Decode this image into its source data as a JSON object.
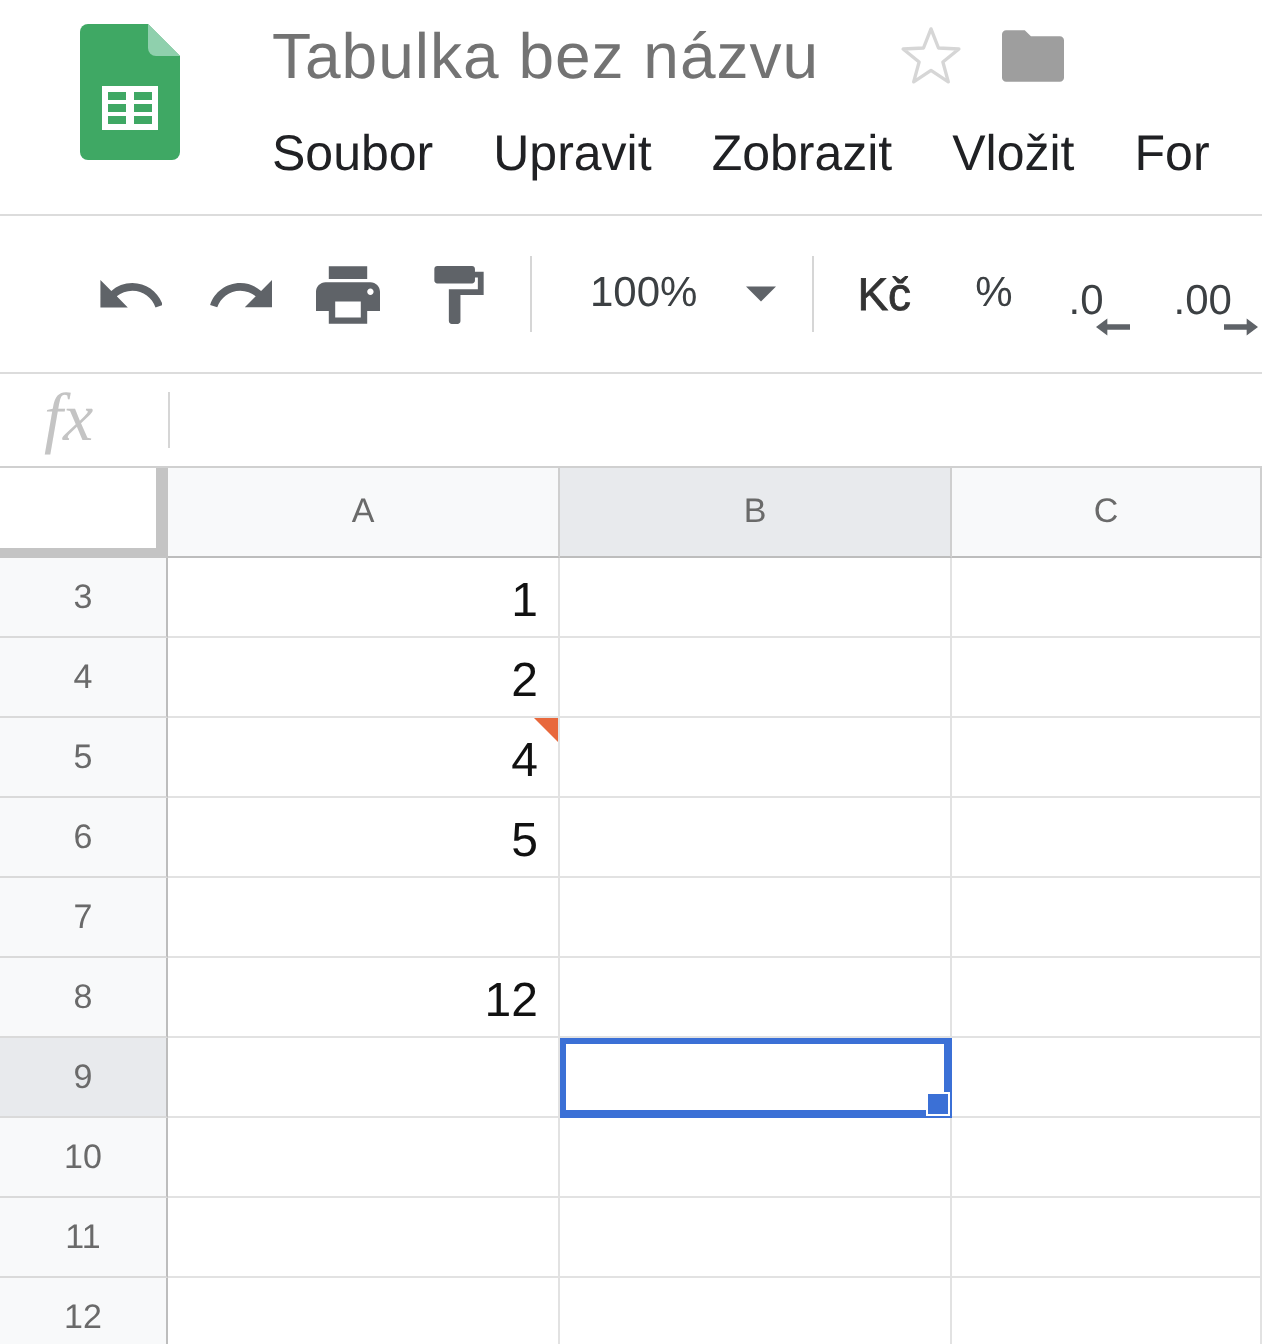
{
  "header": {
    "title": "Tabulka bez názvu",
    "starred": false,
    "menu": [
      "Soubor",
      "Upravit",
      "Zobrazit",
      "Vložit",
      "For"
    ]
  },
  "toolbar": {
    "zoom": "100%",
    "currency": "Kč",
    "percent": "%",
    "decrease_decimals": ".0",
    "increase_decimals": ".00"
  },
  "formula_bar": {
    "label": "fx"
  },
  "sheet": {
    "columns": [
      {
        "label": "A",
        "selected": false
      },
      {
        "label": "B",
        "selected": true
      },
      {
        "label": "C",
        "selected": false
      }
    ],
    "rows": [
      {
        "number": "3",
        "selected": false,
        "cells": [
          {
            "value": "1",
            "selected": false,
            "note": false
          },
          {
            "selected": false,
            "note": false
          },
          {
            "selected": false,
            "note": false
          }
        ]
      },
      {
        "number": "4",
        "selected": false,
        "cells": [
          {
            "value": "2",
            "selected": false,
            "note": false
          },
          {
            "selected": false,
            "note": false
          },
          {
            "selected": false,
            "note": false
          }
        ]
      },
      {
        "number": "5",
        "selected": false,
        "cells": [
          {
            "value": "4",
            "selected": false,
            "note": true
          },
          {
            "selected": false,
            "note": false
          },
          {
            "selected": false,
            "note": false
          }
        ]
      },
      {
        "number": "6",
        "selected": false,
        "cells": [
          {
            "value": "5",
            "selected": false,
            "note": false
          },
          {
            "selected": false,
            "note": false
          },
          {
            "selected": false,
            "note": false
          }
        ]
      },
      {
        "number": "7",
        "selected": false,
        "cells": [
          {
            "selected": false,
            "note": false
          },
          {
            "selected": false,
            "note": false
          },
          {
            "selected": false,
            "note": false
          }
        ]
      },
      {
        "number": "8",
        "selected": false,
        "cells": [
          {
            "value": "12",
            "selected": false,
            "note": false
          },
          {
            "selected": false,
            "note": false
          },
          {
            "selected": false,
            "note": false
          }
        ]
      },
      {
        "number": "9",
        "selected": true,
        "cells": [
          {
            "selected": false,
            "note": false
          },
          {
            "selected": true,
            "note": false
          },
          {
            "selected": false,
            "note": false
          }
        ]
      },
      {
        "number": "10",
        "selected": false,
        "cells": [
          {
            "selected": false,
            "note": false
          },
          {
            "selected": false,
            "note": false
          },
          {
            "selected": false,
            "note": false
          }
        ]
      },
      {
        "number": "11",
        "selected": false,
        "cells": [
          {
            "selected": false,
            "note": false
          },
          {
            "selected": false,
            "note": false
          },
          {
            "selected": false,
            "note": false
          }
        ]
      },
      {
        "number": "12",
        "selected": false,
        "cells": [
          {
            "selected": false,
            "note": false
          },
          {
            "selected": false,
            "note": false
          },
          {
            "selected": false,
            "note": false
          }
        ]
      }
    ]
  }
}
